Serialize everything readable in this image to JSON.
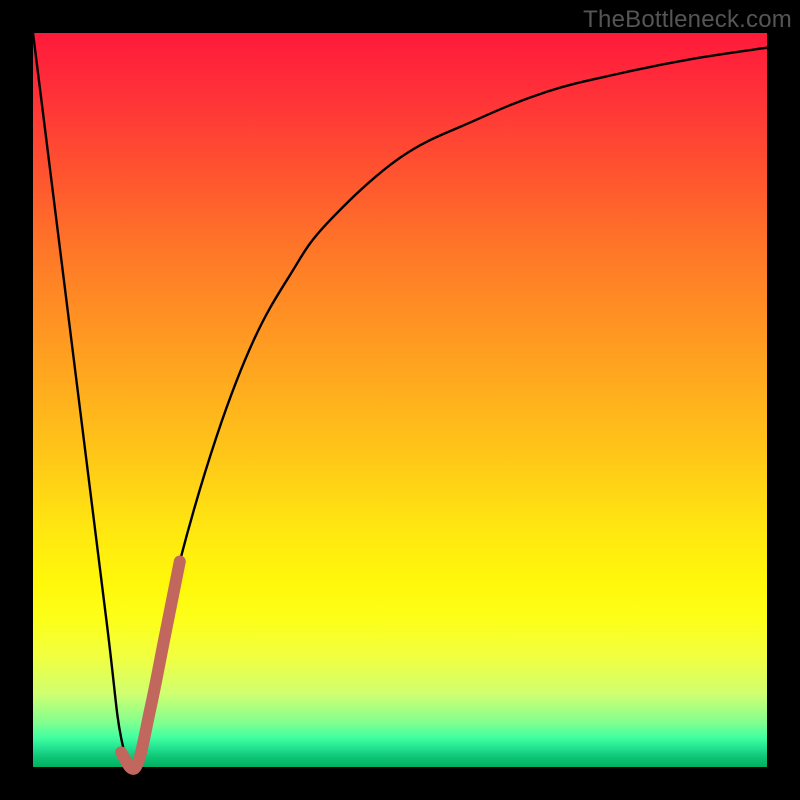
{
  "watermark": "TheBottleneck.com",
  "colors": {
    "background": "#000000",
    "curve_main": "#000000",
    "curve_highlight": "#c1675d",
    "gradient_top": "#ff1a3a",
    "gradient_bottom": "#00b060"
  },
  "chart_data": {
    "type": "line",
    "title": "",
    "xlabel": "",
    "ylabel": "",
    "xlim": [
      0,
      100
    ],
    "ylim": [
      0,
      100
    ],
    "series": [
      {
        "name": "bottleneck_curve",
        "x": [
          0,
          5,
          10,
          12,
          14,
          16,
          18,
          20,
          25,
          30,
          35,
          40,
          50,
          60,
          70,
          80,
          90,
          100
        ],
        "y": [
          100,
          60,
          20,
          4,
          0,
          8,
          18,
          28,
          45,
          58,
          67,
          74,
          83,
          88,
          92,
          94.5,
          96.5,
          98
        ]
      },
      {
        "name": "highlight_segment",
        "x": [
          12,
          14,
          16,
          18,
          20
        ],
        "y": [
          2,
          0,
          8,
          18,
          28
        ]
      }
    ]
  }
}
